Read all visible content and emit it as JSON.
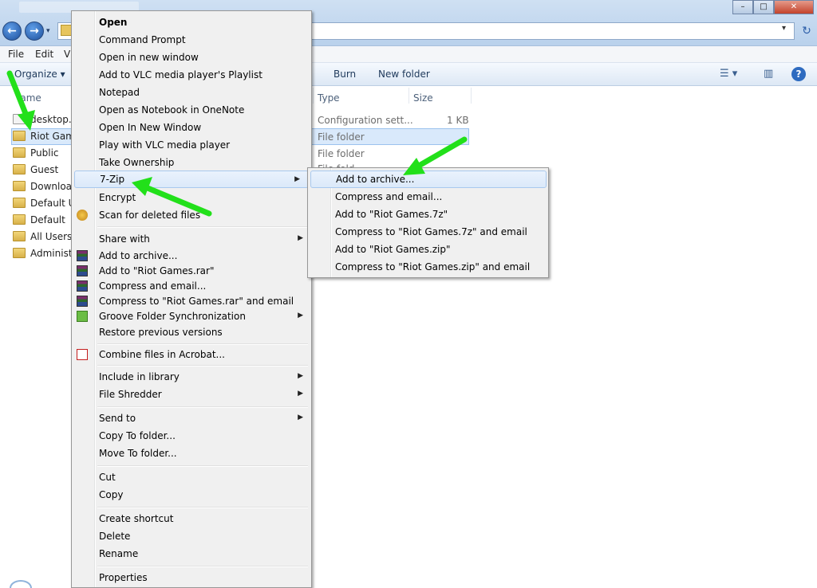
{
  "window": {
    "minimize_glyph": "–",
    "maximize_glyph": "□",
    "close_glyph": "✕"
  },
  "nav": {
    "back_glyph": "←",
    "forward_glyph": "→",
    "dropdown_glyph": "▾",
    "refresh_glyph": "↻"
  },
  "menubar": {
    "file": "File",
    "edit": "Edit",
    "view": "Vi"
  },
  "commandbar": {
    "organize": "Organize ▾",
    "burn": "Burn",
    "new_folder": "New folder",
    "view_glyph": "☰ ▾",
    "pane_glyph": "▥",
    "help_glyph": "?"
  },
  "columns": {
    "name": "lame",
    "type": "Type",
    "size": "Size"
  },
  "files": [
    {
      "name": "desktop.in",
      "type": "Configuration sett...",
      "size": "1 KB",
      "icon": "doc-icon"
    },
    {
      "name": "Riot Game",
      "type": "File folder",
      "size": "",
      "icon": "folder-icon"
    },
    {
      "name": "Public",
      "type": "File folder",
      "size": "",
      "icon": "folder-icon"
    },
    {
      "name": "Guest",
      "type": "File fold",
      "size": "",
      "icon": "folder-icon"
    },
    {
      "name": "Downloac",
      "type": "",
      "size": "",
      "icon": "download-folder-icon"
    },
    {
      "name": "Default Us",
      "type": "",
      "size": "",
      "icon": "folder-icon"
    },
    {
      "name": "Default",
      "type": "",
      "size": "",
      "icon": "folder-icon"
    },
    {
      "name": "All Users",
      "type": "",
      "size": "",
      "icon": "folder-icon"
    },
    {
      "name": "Administ",
      "type": "",
      "size": "",
      "icon": "folder-icon"
    }
  ],
  "context_menu": {
    "items": [
      {
        "label": "Open",
        "bold": true
      },
      {
        "label": "Command Prompt"
      },
      {
        "label": "Open in new window"
      },
      {
        "label": "Add to VLC media player's Playlist"
      },
      {
        "label": "Notepad"
      },
      {
        "label": "Open as Notebook in OneNote"
      },
      {
        "label": "Open In New Window"
      },
      {
        "label": "Play with VLC media player"
      },
      {
        "label": "Take Ownership"
      },
      {
        "label": "7-Zip",
        "submenu": true,
        "highlighted": true
      },
      {
        "label": "Encrypt"
      },
      {
        "label": "Scan for deleted files",
        "icon": "scan-icon"
      },
      {
        "label": "Share with",
        "submenu": true
      },
      {
        "label": "Add to archive...",
        "icon": "winrar-icon"
      },
      {
        "label": "Add to \"Riot Games.rar\"",
        "icon": "winrar-icon"
      },
      {
        "label": "Compress and email...",
        "icon": "winrar-icon"
      },
      {
        "label": "Compress to \"Riot Games.rar\" and email",
        "icon": "winrar-icon"
      },
      {
        "label": "Groove Folder Synchronization",
        "submenu": true,
        "icon": "groove-icon"
      },
      {
        "label": "Restore previous versions"
      },
      {
        "label": "Combine files in Acrobat...",
        "icon": "acrobat-icon"
      },
      {
        "label": "Include in library",
        "submenu": true
      },
      {
        "label": "File Shredder",
        "submenu": true
      },
      {
        "label": "Send to",
        "submenu": true
      },
      {
        "label": "Copy To folder..."
      },
      {
        "label": "Move To folder..."
      },
      {
        "label": "Cut"
      },
      {
        "label": "Copy"
      },
      {
        "label": "Create shortcut"
      },
      {
        "label": "Delete"
      },
      {
        "label": "Rename"
      },
      {
        "label": "Properties"
      }
    ],
    "submenu_arrow": "▶"
  },
  "zip_submenu": {
    "items": [
      {
        "label": "Add to archive...",
        "highlighted": true
      },
      {
        "label": "Compress and email..."
      },
      {
        "label": "Add to \"Riot Games.7z\""
      },
      {
        "label": "Compress to \"Riot Games.7z\" and email"
      },
      {
        "label": "Add to \"Riot Games.zip\""
      },
      {
        "label": "Compress to \"Riot Games.zip\" and email"
      }
    ]
  },
  "annotation_color": "#22e01a"
}
